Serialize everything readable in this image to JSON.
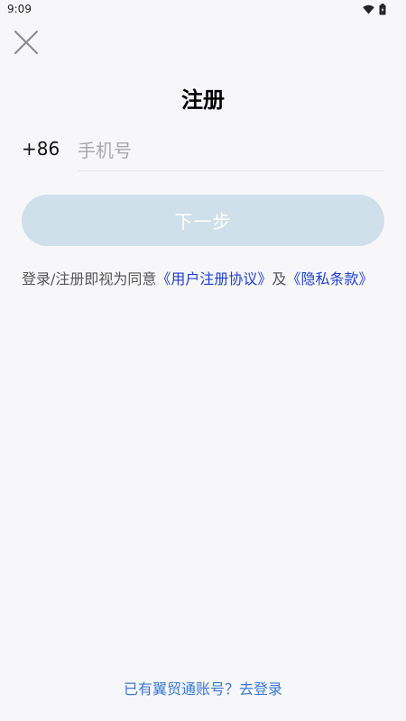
{
  "status_bar": {
    "time": "9:09",
    "icons": [
      "wifi-icon",
      "battery-icon"
    ]
  },
  "header": {
    "close_icon": "close-icon",
    "title": "注册"
  },
  "form": {
    "country_code": "+86",
    "phone_placeholder": "手机号",
    "phone_value": "",
    "next_label": "下一步"
  },
  "agreement": {
    "prefix": "登录/注册即视为同意",
    "user_agreement_link": "《用户注册协议》",
    "conjunction": "及",
    "privacy_link": "《隐私条款》"
  },
  "footer": {
    "login_prompt": "已有翼贸通账号？去登录"
  },
  "colors": {
    "background": "#f7f7f9",
    "button_disabled": "#cfe0ea",
    "link": "#1f3fd1",
    "footer_link": "#3a78d6"
  }
}
